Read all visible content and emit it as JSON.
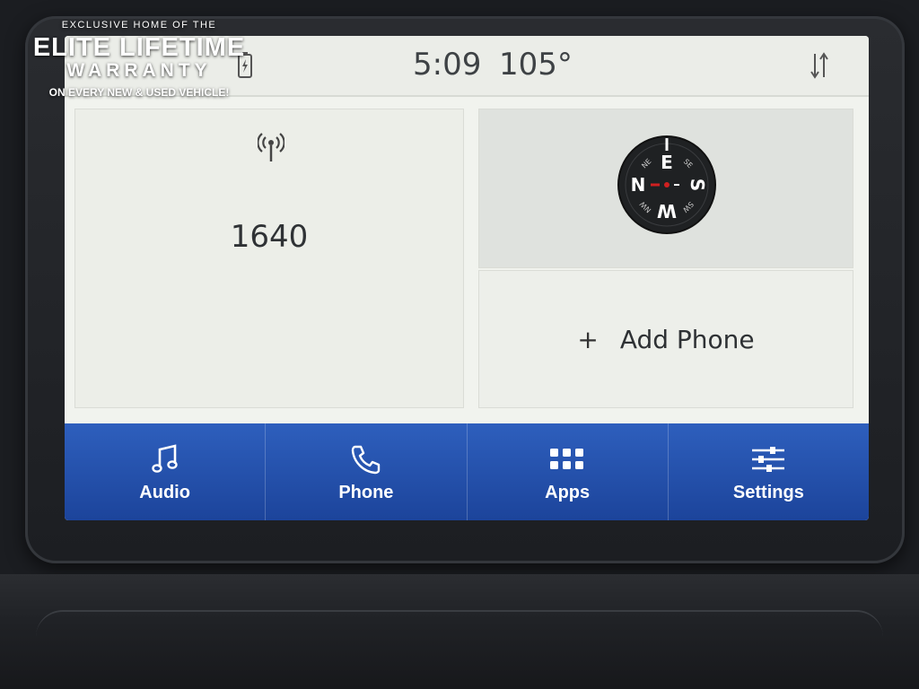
{
  "watermark": {
    "top": "EXCLUSIVE HOME OF THE",
    "main": "ELITE LIFETIME",
    "sub": "WARRANTY",
    "bottom": "ON EVERY NEW & USED VEHICLE!"
  },
  "status": {
    "time": "5:09",
    "temperature": "105°",
    "icons": [
      "battery-charging-icon",
      "sync-arrows-icon"
    ]
  },
  "radio": {
    "icon": "radio-antenna-icon",
    "frequency": "1640"
  },
  "compass": {
    "N": "N",
    "E": "E",
    "S": "S",
    "W": "W",
    "NE": "NE",
    "SE": "SE",
    "SW": "SW",
    "NW": "NW"
  },
  "phone": {
    "icon": "plus-icon",
    "label": "Add Phone"
  },
  "nav": {
    "items": [
      {
        "label": "Audio",
        "icon": "music-note-icon"
      },
      {
        "label": "Phone",
        "icon": "phone-handset-icon"
      },
      {
        "label": "Apps",
        "icon": "apps-grid-icon"
      },
      {
        "label": "Settings",
        "icon": "sliders-icon"
      }
    ]
  },
  "colors": {
    "nav_bar": "#1c449b",
    "screen_bg": "#f1f3ee",
    "compass_needle": "#d02020"
  }
}
